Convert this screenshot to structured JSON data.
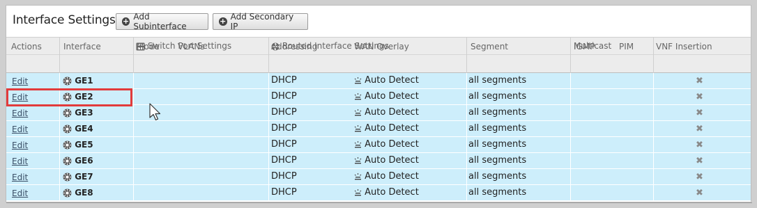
{
  "header": {
    "title": "Interface Settings",
    "add_subinterface_label": "Add Subinterface",
    "add_secondary_ip_label": "Add Secondary IP"
  },
  "groups": {
    "switch_port": "Switch Port Settings",
    "routed_interface": "Routed Interface Settings",
    "multicast": "Multicast"
  },
  "columns": {
    "actions": "Actions",
    "interface": "Interface",
    "mode": "Mode",
    "vlans": "VLANs",
    "addressing": "Addressing",
    "wan_overlay": "WAN Overlay",
    "segment": "Segment",
    "igmp": "IGMP",
    "pim": "PIM",
    "vnf_insertion": "VNF Insertion"
  },
  "rows": [
    {
      "action": "Edit",
      "interface": "GE1",
      "addressing": "DHCP",
      "wan_overlay": "Auto Detect",
      "segment": "all segments"
    },
    {
      "action": "Edit",
      "interface": "GE2",
      "addressing": "DHCP",
      "wan_overlay": "Auto Detect",
      "segment": "all segments"
    },
    {
      "action": "Edit",
      "interface": "GE3",
      "addressing": "DHCP",
      "wan_overlay": "Auto Detect",
      "segment": "all segments"
    },
    {
      "action": "Edit",
      "interface": "GE4",
      "addressing": "DHCP",
      "wan_overlay": "Auto Detect",
      "segment": "all segments"
    },
    {
      "action": "Edit",
      "interface": "GE5",
      "addressing": "DHCP",
      "wan_overlay": "Auto Detect",
      "segment": "all segments"
    },
    {
      "action": "Edit",
      "interface": "GE6",
      "addressing": "DHCP",
      "wan_overlay": "Auto Detect",
      "segment": "all segments"
    },
    {
      "action": "Edit",
      "interface": "GE7",
      "addressing": "DHCP",
      "wan_overlay": "Auto Detect",
      "segment": "all segments"
    },
    {
      "action": "Edit",
      "interface": "GE8",
      "addressing": "DHCP",
      "wan_overlay": "Auto Detect",
      "segment": "all segments"
    }
  ],
  "icons": {
    "add": "plus-circle-icon",
    "switch_port": "switch-port-icon",
    "routed": "router-icon",
    "interface": "interface-icon",
    "wan_overlay": "auto-detect-icon",
    "vnf": "x-icon"
  },
  "colors": {
    "row_bg": "#cdeefb",
    "header_bg": "#ececec",
    "highlight": "#e23b3b"
  }
}
